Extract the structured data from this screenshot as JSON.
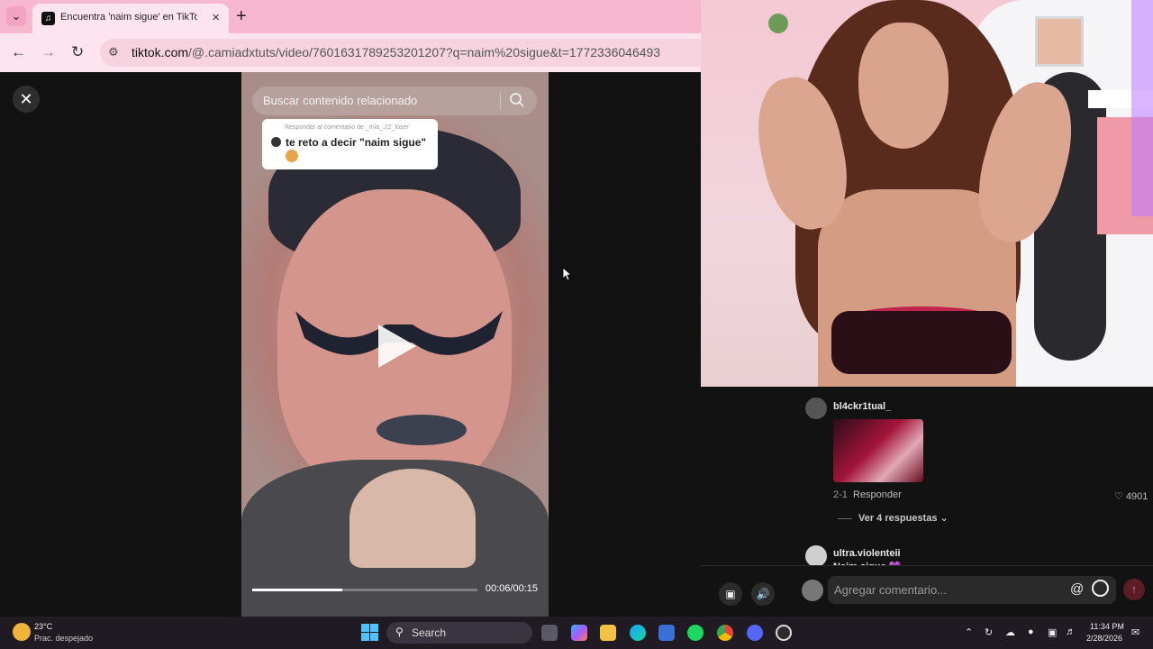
{
  "browser": {
    "tab_title": "Encuentra 'naim sigue' en TikTok | Busca c",
    "url_host": "tiktok.com",
    "url_path": "/@.camiadxtuts/video/7601631789253201207?q=naim%20sigue&t=1772336046493"
  },
  "video": {
    "search_placeholder": "Buscar contenido relacionado",
    "reply_meta": "Responder al comentario de _mia_.22_loser",
    "reply_text": "te reto a decir \"naim sigue\"",
    "time": "00:06/00:15",
    "progress": 0.4
  },
  "comments": {
    "items": [
      {
        "username": "bl4ckr1tual_",
        "date": "2-1",
        "reply_label": "Responder",
        "likes": "4901",
        "view_replies": "Ver 4 respuestas"
      },
      {
        "username": "ultra.violenteii",
        "text": "Naim sigue 💜"
      }
    ],
    "input_placeholder": "Agregar comentario...",
    "at_symbol": "@"
  },
  "taskbar": {
    "weather_temp": "23°C",
    "weather_desc": "Prac. despejado",
    "search_label": "Search",
    "time": "11:34 PM",
    "date": "2/28/2026"
  },
  "colors": {
    "tab_strip": "#f6b7cf",
    "toolbar": "#fde4ee",
    "player_bg": "#121212",
    "taskbar": "#201a22",
    "send_button": "#5a1d26"
  },
  "icons": {
    "close": "close-icon",
    "search": "search-icon",
    "play": "play-icon",
    "heart": "heart-icon",
    "emoji": "emoji-icon"
  }
}
